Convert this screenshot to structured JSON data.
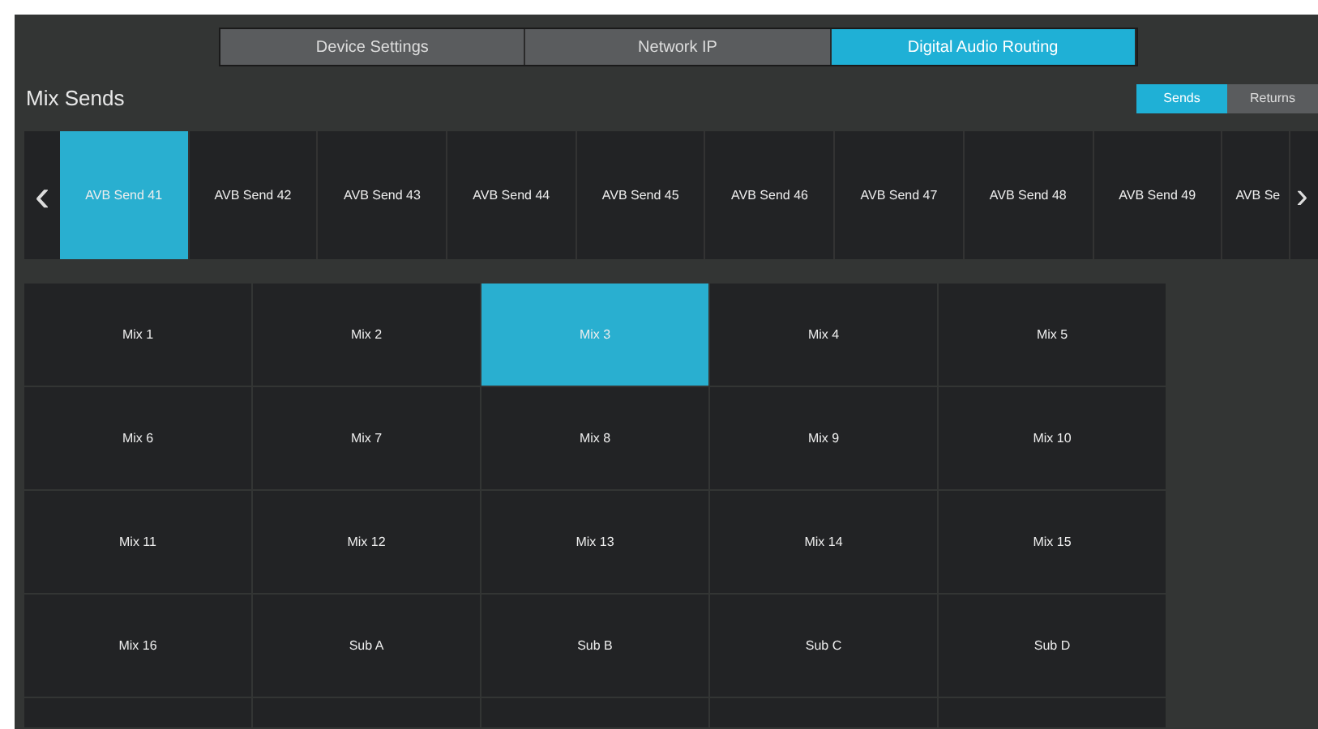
{
  "tabs": [
    {
      "label": "Device Settings",
      "selected": false
    },
    {
      "label": "Network IP",
      "selected": false
    },
    {
      "label": "Digital Audio Routing",
      "selected": true
    }
  ],
  "section_title": "Mix Sends",
  "mode_toggle": [
    {
      "label": "Sends",
      "selected": true
    },
    {
      "label": "Returns",
      "selected": false
    }
  ],
  "send_strip": {
    "prev": "‹",
    "next": "›",
    "items": [
      {
        "label": "AVB Send 41",
        "selected": true
      },
      {
        "label": "AVB Send 42",
        "selected": false
      },
      {
        "label": "AVB Send 43",
        "selected": false
      },
      {
        "label": "AVB Send 44",
        "selected": false
      },
      {
        "label": "AVB Send 45",
        "selected": false
      },
      {
        "label": "AVB Send 46",
        "selected": false
      },
      {
        "label": "AVB Send 47",
        "selected": false
      },
      {
        "label": "AVB Send 48",
        "selected": false
      },
      {
        "label": "AVB Send 49",
        "selected": false
      },
      {
        "label": "AVB Se",
        "selected": false
      }
    ]
  },
  "mix_grid": [
    {
      "label": "Mix 1",
      "selected": false
    },
    {
      "label": "Mix 2",
      "selected": false
    },
    {
      "label": "Mix 3",
      "selected": true
    },
    {
      "label": "Mix 4",
      "selected": false
    },
    {
      "label": "Mix 5",
      "selected": false
    },
    {
      "label": "Mix 6",
      "selected": false
    },
    {
      "label": "Mix 7",
      "selected": false
    },
    {
      "label": "Mix 8",
      "selected": false
    },
    {
      "label": "Mix 9",
      "selected": false
    },
    {
      "label": "Mix 10",
      "selected": false
    },
    {
      "label": "Mix 11",
      "selected": false
    },
    {
      "label": "Mix 12",
      "selected": false
    },
    {
      "label": "Mix 13",
      "selected": false
    },
    {
      "label": "Mix 14",
      "selected": false
    },
    {
      "label": "Mix 15",
      "selected": false
    },
    {
      "label": "Mix 16",
      "selected": false
    },
    {
      "label": "Sub A",
      "selected": false
    },
    {
      "label": "Sub B",
      "selected": false
    },
    {
      "label": "Sub C",
      "selected": false
    },
    {
      "label": "Sub D",
      "selected": false
    }
  ]
}
